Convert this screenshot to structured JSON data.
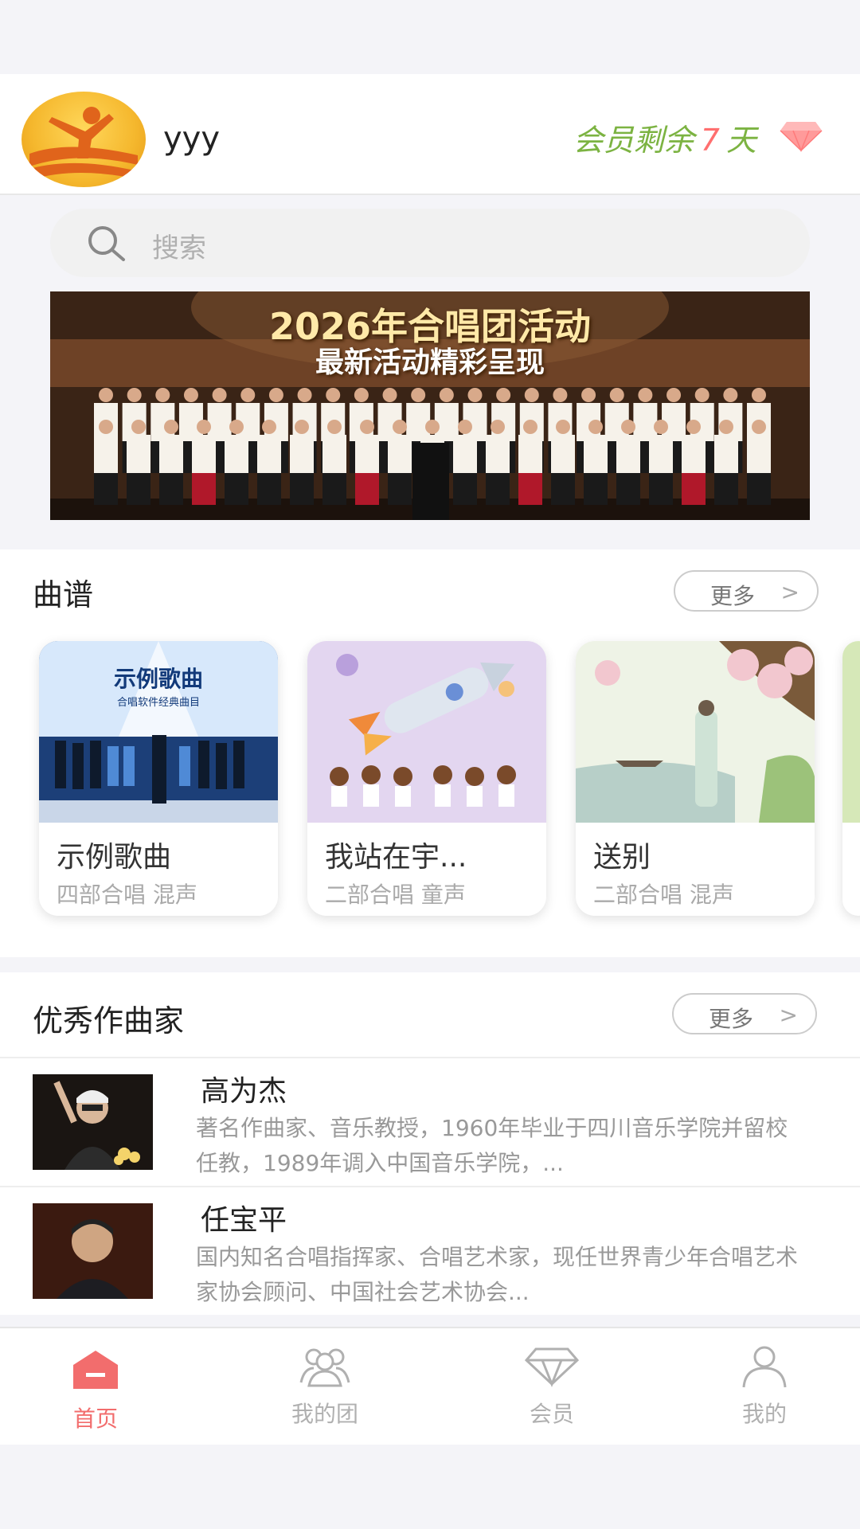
{
  "header": {
    "username": "yyy",
    "member_prefix": "会员剩余",
    "member_days": "7",
    "member_suffix": "天",
    "accent_color": "#7cb342",
    "days_color": "#ff6f6f"
  },
  "search": {
    "placeholder": "搜索"
  },
  "banner": {
    "title": "2026年合唱团活动",
    "subtitle": "最新活动精彩呈现"
  },
  "scores": {
    "title": "曲谱",
    "more_label": "更多",
    "items": [
      {
        "title": "示例歌曲",
        "tags": "四部合唱 混声",
        "cover_title": "示例歌曲",
        "cover_sub": "合唱软件经典曲目"
      },
      {
        "title": "我站在宇...",
        "tags": "二部合唱 童声"
      },
      {
        "title": "送别",
        "tags": "二部合唱 混声"
      }
    ]
  },
  "composers": {
    "title": "优秀作曲家",
    "more_label": "更多",
    "items": [
      {
        "name": "高为杰",
        "desc": "著名作曲家、音乐教授，1960年毕业于四川音乐学院并留校任教，1989年调入中国音乐学院，..."
      },
      {
        "name": "任宝平",
        "desc": "国内知名合唱指挥家、合唱艺术家，现任世界青少年合唱艺术家协会顾问、中国社会艺术协会..."
      }
    ]
  },
  "tabs": [
    {
      "label": "首页",
      "icon": "home-icon",
      "active": true
    },
    {
      "label": "我的团",
      "icon": "group-icon",
      "active": false
    },
    {
      "label": "会员",
      "icon": "diamond-icon",
      "active": false
    },
    {
      "label": "我的",
      "icon": "person-icon",
      "active": false
    }
  ],
  "colors": {
    "active_tab": "#f26d6d",
    "inactive_tab": "#b0b0b0"
  }
}
